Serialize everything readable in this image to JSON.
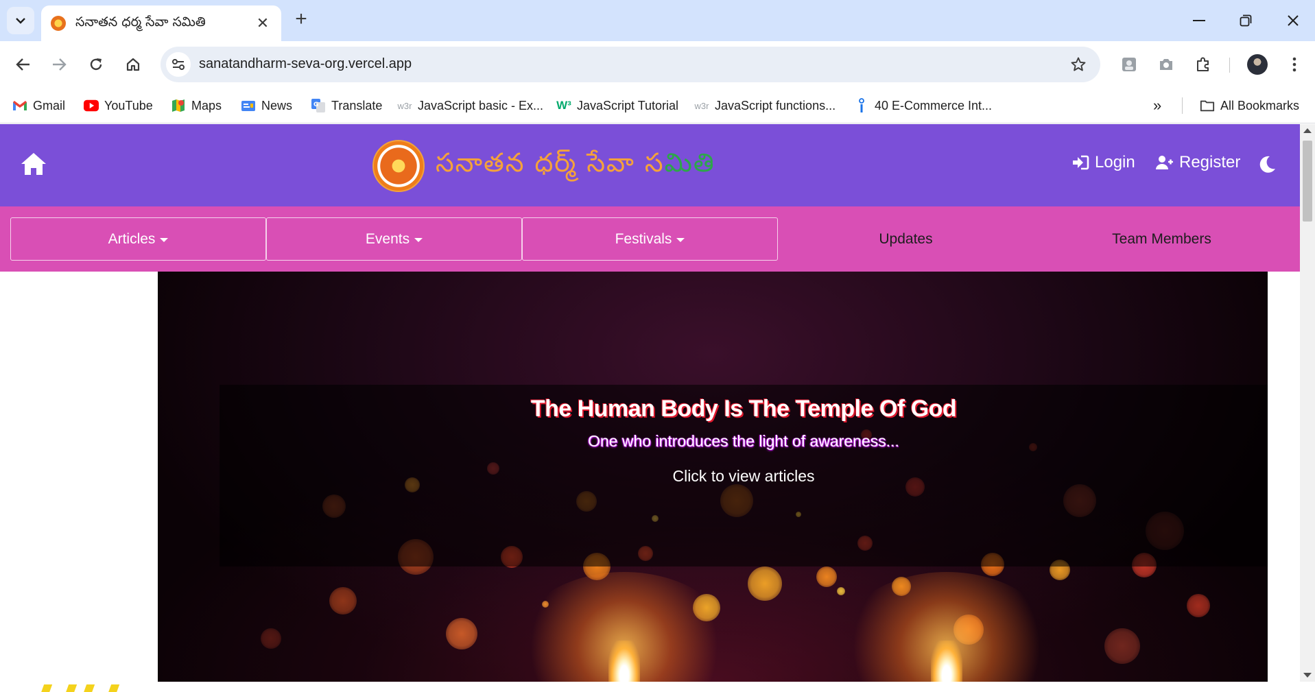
{
  "browser": {
    "tab": {
      "title": "సనాతన ధర్మ సేవా సమితి",
      "close_label": "✕"
    },
    "new_tab_label": "+",
    "url": "sanatandharm-seva-org.vercel.app",
    "bookmarks": [
      {
        "label": "Gmail",
        "icon": "gmail-icon"
      },
      {
        "label": "YouTube",
        "icon": "youtube-icon"
      },
      {
        "label": "Maps",
        "icon": "maps-icon"
      },
      {
        "label": "News",
        "icon": "news-icon"
      },
      {
        "label": "Translate",
        "icon": "translate-icon"
      },
      {
        "label": "JavaScript basic - Ex...",
        "icon": "w3resource-icon"
      },
      {
        "label": "JavaScript Tutorial",
        "icon": "w3schools-icon"
      },
      {
        "label": "JavaScript functions...",
        "icon": "w3resource-icon"
      },
      {
        "label": "40 E-Commerce Int...",
        "icon": "info-icon"
      }
    ],
    "all_bookmarks_label": "All Bookmarks",
    "overflow_label": "»"
  },
  "site": {
    "name_part1": "సనాతన ధర్మ్ సేవా స",
    "name_part2": "మితి",
    "login_label": "Login",
    "register_label": "Register"
  },
  "nav": {
    "items": [
      {
        "label": "Articles",
        "dropdown": true
      },
      {
        "label": "Events",
        "dropdown": true
      },
      {
        "label": "Festivals",
        "dropdown": true
      },
      {
        "label": "Updates",
        "dropdown": false
      },
      {
        "label": "Team Members",
        "dropdown": false
      }
    ]
  },
  "hero": {
    "title": "The Human Body Is The Temple Of God",
    "subtitle": "One who introduces the light of awareness...",
    "link": "Click to view articles"
  },
  "colors": {
    "header_bg": "#7b4fd8",
    "nav_bg": "#d94fb5",
    "title_shadow": "#e0182d",
    "subtitle_shadow": "#b218d8"
  }
}
